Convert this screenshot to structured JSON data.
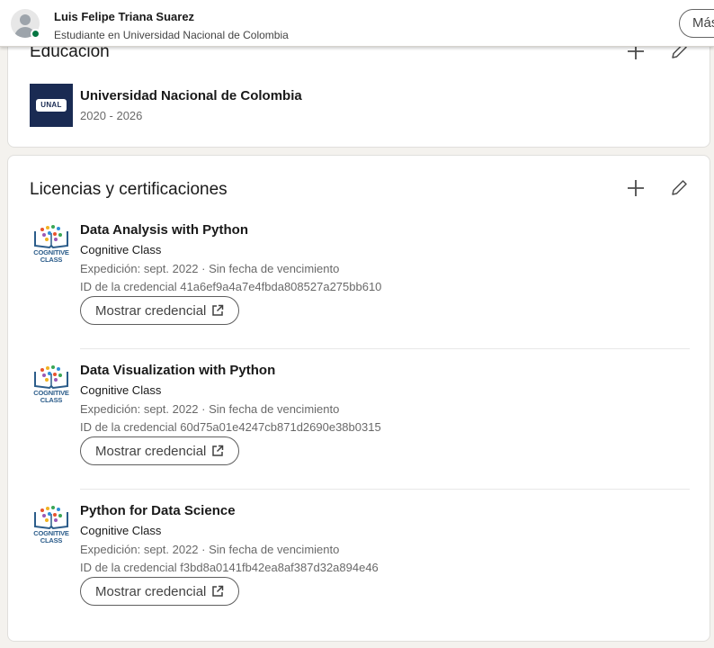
{
  "header": {
    "name": "Luis Felipe Triana Suarez",
    "headline": "Estudiante en Universidad Nacional de Colombia",
    "more_label": "Más"
  },
  "education": {
    "title": "Educación",
    "entries": [
      {
        "school": "Universidad Nacional de Colombia",
        "dates": "2020 - 2026",
        "logo_text": "UNAL"
      }
    ]
  },
  "licenses": {
    "title": "Licencias y certificaciones",
    "items": [
      {
        "name": "Data Analysis with Python",
        "issuer": "Cognitive Class",
        "date": "Expedición: sept. 2022 · Sin fecha de vencimiento",
        "credential_id": "ID de la credencial 41a6ef9a4a7e4fbda808527a275bb610",
        "button_label": "Mostrar credencial",
        "logo_text": "COGNITIVE CLASS"
      },
      {
        "name": "Data Visualization with Python",
        "issuer": "Cognitive Class",
        "date": "Expedición: sept. 2022 · Sin fecha de vencimiento",
        "credential_id": "ID de la credencial 60d75a01e4247cb871d2690e38b0315",
        "button_label": "Mostrar credencial",
        "logo_text": "COGNITIVE CLASS"
      },
      {
        "name": "Python for Data Science",
        "issuer": "Cognitive Class",
        "date": "Expedición: sept. 2022 · Sin fecha de vencimiento",
        "credential_id": "ID de la credencial f3bd8a0141fb42ea8af387d32a894e46",
        "button_label": "Mostrar credencial",
        "logo_text": "COGNITIVE CLASS"
      }
    ]
  },
  "icons": {
    "add": "plus-icon",
    "edit": "pencil-icon",
    "external": "external-link-icon",
    "presence": "online-status-dot"
  },
  "colors": {
    "page_bg": "#f4f2ee",
    "card_bg": "#ffffff",
    "presence_green": "#057642",
    "unal_navy": "#1a2b53",
    "cognitive_blue": "#2b5c8a"
  }
}
